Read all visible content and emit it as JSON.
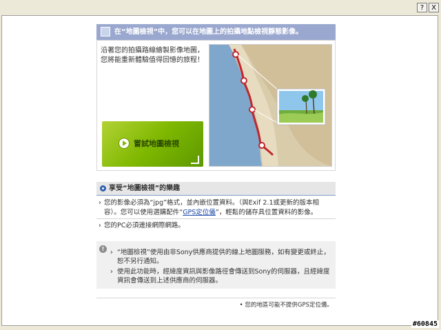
{
  "titlebar": {
    "help_label": "?",
    "close_label": "X"
  },
  "header": {
    "title": "在“地圖檢視”中，您可以在地圖上的拍攝地點檢視靜態影像。"
  },
  "intro": {
    "text": "沿著您的拍攝路線繪製影像地圖，您將能重新體驗值得回憶的旅程！",
    "try_button_label": "嘗試地圖檢視"
  },
  "section": {
    "title": "享受“地圖檢視”的樂趣"
  },
  "requirements": [
    {
      "marker": "›",
      "pre": "您的影像必須為“jpg”格式，並內嵌位置資料。（與Exif 2.1或更新的版本相容）。您可以使用選購配件“",
      "link": "GPS定位儀",
      "post": "”，輕鬆的儲存具位置資料的影像。"
    },
    {
      "marker": "›",
      "text": "您的PC必須連接網際網路。"
    }
  ],
  "notes": {
    "icon_label": "!",
    "items": [
      {
        "marker": "›",
        "text": "“地圖檢視”使用由非Sony供應商提供的線上地圖服務，如有變更或終止，恕不另行通知。"
      },
      {
        "marker": "›",
        "text": "使用此功能時，經緯度資訊與影像路徑會傳送到Sony的伺服器，且經緯度資訊會傳送到上述供應商的伺服器。"
      }
    ]
  },
  "footer": {
    "text": "• 您的地區可能不提供GPS定位儀。"
  },
  "watermark": "#60845",
  "colors": {
    "header_bg": "#9aa8cf",
    "button_green": "#7fb800",
    "accent_blue": "#2f5fb1",
    "pin_red": "#c0262d"
  }
}
